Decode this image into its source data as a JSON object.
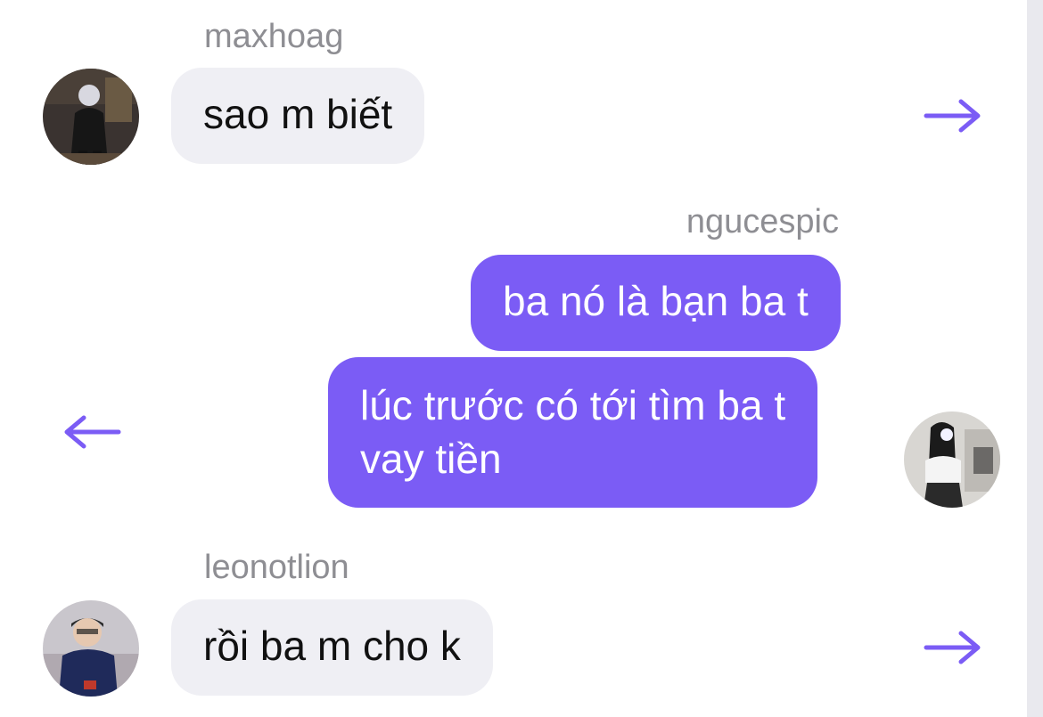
{
  "accent_color": "#7b5cf5",
  "messages": [
    {
      "sender": "maxhoag",
      "direction": "incoming",
      "lines": [
        "sao m biết"
      ],
      "avatar_icon": "avatar-photo-icon",
      "reply_arrow_icon": "arrow-right-icon"
    },
    {
      "sender": "ngucespic",
      "direction": "outgoing",
      "lines": [
        "ba nó là bạn ba t"
      ]
    },
    {
      "direction": "outgoing",
      "lines": [
        "lúc trước có tới tìm ba t",
        "vay tiền"
      ],
      "avatar_icon": "avatar-photo-icon",
      "reply_arrow_icon": "arrow-left-icon"
    },
    {
      "sender": "leonotlion",
      "direction": "incoming",
      "lines": [
        "rồi ba m cho k"
      ],
      "avatar_icon": "avatar-photo-icon",
      "reply_arrow_icon": "arrow-right-icon"
    }
  ]
}
